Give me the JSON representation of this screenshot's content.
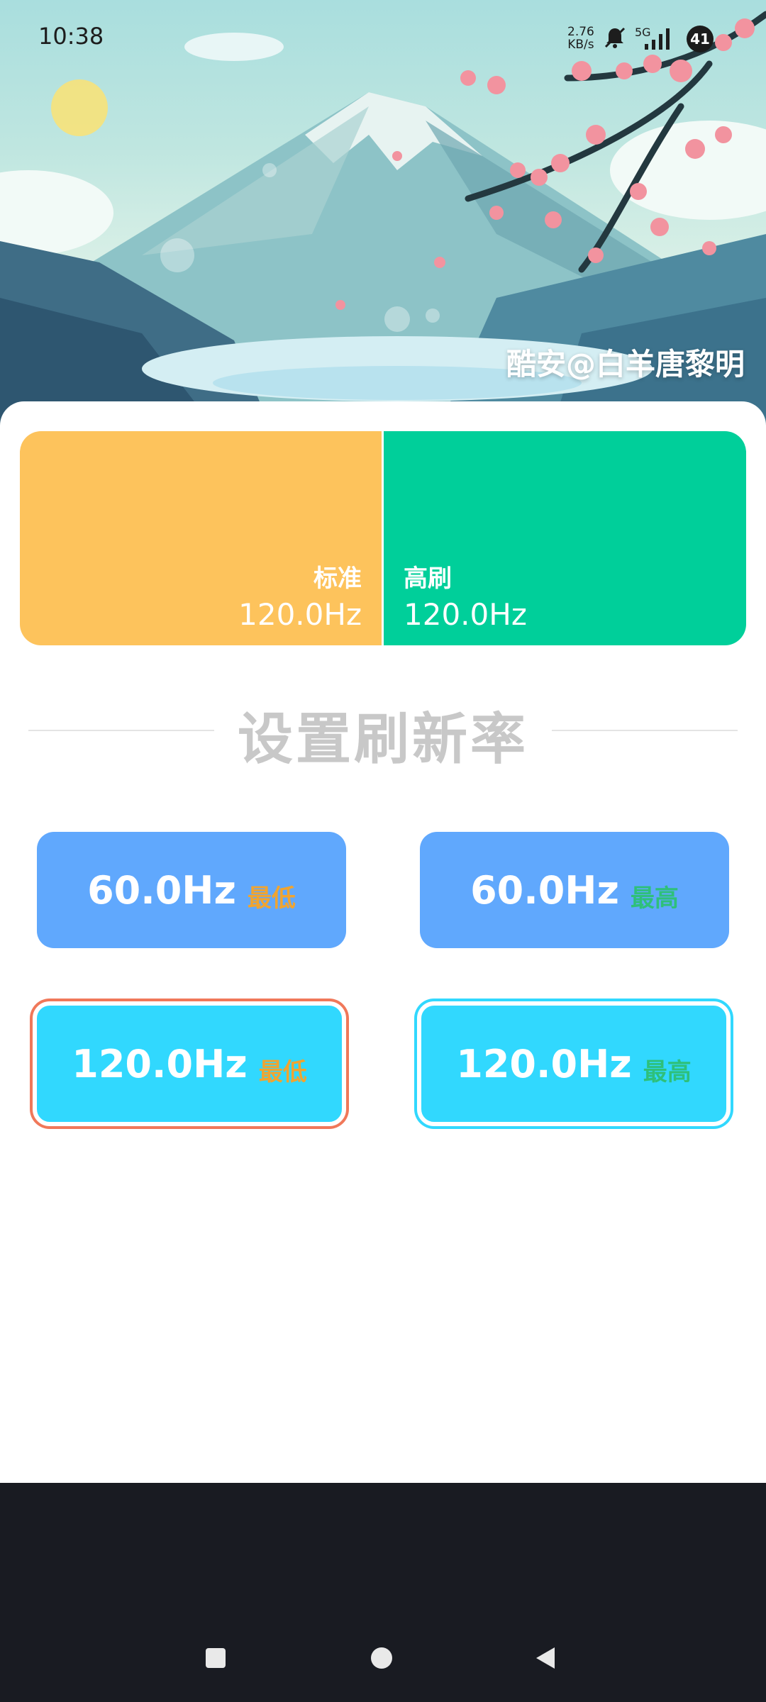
{
  "status_bar": {
    "time": "10:38",
    "net_speed_value": "2.76",
    "net_speed_unit": "KB/s",
    "network": "5G",
    "battery": "41",
    "icons": [
      "mute-bell-icon",
      "signal-icon",
      "battery-icon"
    ]
  },
  "header": {
    "watermark": "酷安@白羊唐黎明"
  },
  "summary": {
    "standard_label": "标准",
    "standard_value": "120.0Hz",
    "high_label": "高刷",
    "high_value": "120.0Hz",
    "standard_color": "#fdc35c",
    "high_color": "#00cf9a"
  },
  "section": {
    "title": "设置刷新率"
  },
  "buttons": [
    {
      "hz": "60.0Hz",
      "tag": "最低",
      "tag_color": "#f0a430"
    },
    {
      "hz": "60.0Hz",
      "tag": "最高",
      "tag_color": "#2ec07a"
    },
    {
      "hz": "120.0Hz",
      "tag": "最低",
      "tag_color": "#f0a430",
      "selected_border": "#f0785a"
    },
    {
      "hz": "120.0Hz",
      "tag": "最高",
      "tag_color": "#2ec07a",
      "selected_border": "#31d8fe"
    }
  ],
  "nav": {
    "icons": [
      "recents-square-icon",
      "home-circle-icon",
      "back-triangle-icon"
    ]
  }
}
